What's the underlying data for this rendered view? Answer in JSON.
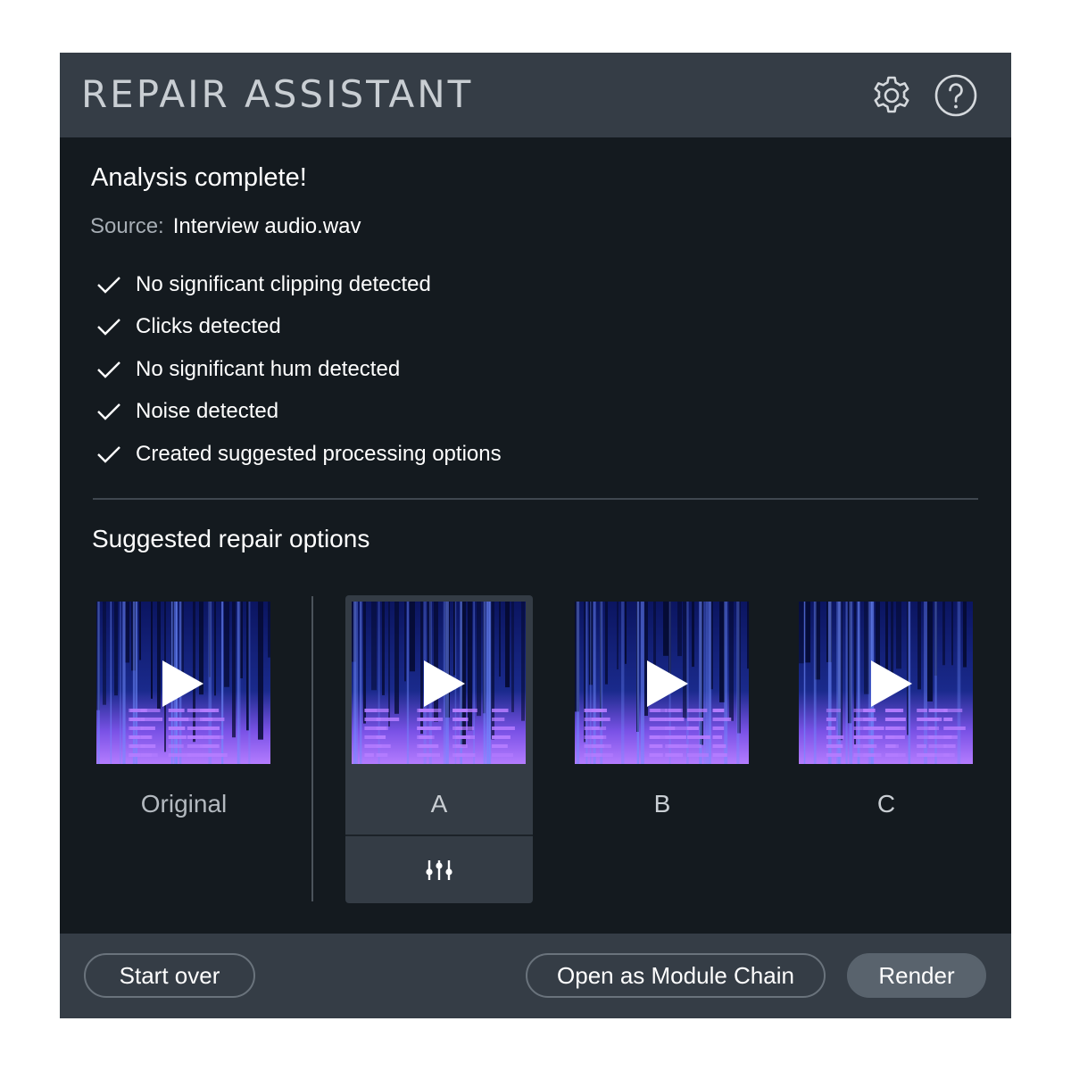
{
  "window": {
    "title": "REPAIR ASSISTANT"
  },
  "header_icons": {
    "settings": "gear-icon",
    "help": "help-circle-icon"
  },
  "analysis": {
    "heading": "Analysis complete!",
    "source_label": "Source:",
    "source_value": "Interview audio.wav",
    "checks": [
      "No significant clipping detected",
      "Clicks detected",
      "No significant hum detected",
      "Noise detected",
      "Created suggested processing options"
    ]
  },
  "suggestions": {
    "heading": "Suggested repair options",
    "options": [
      {
        "label": "Original",
        "selected": false
      },
      {
        "label": "A",
        "selected": true
      },
      {
        "label": "B",
        "selected": false
      },
      {
        "label": "C",
        "selected": false
      }
    ]
  },
  "footer": {
    "start_over": "Start over",
    "open_module_chain": "Open as Module Chain",
    "render": "Render"
  },
  "colors": {
    "panel_bg": "#141a1f",
    "bar_bg": "#353d46",
    "spectrogram_low": "#1a2a8c",
    "spectrogram_high": "#b47cff"
  }
}
